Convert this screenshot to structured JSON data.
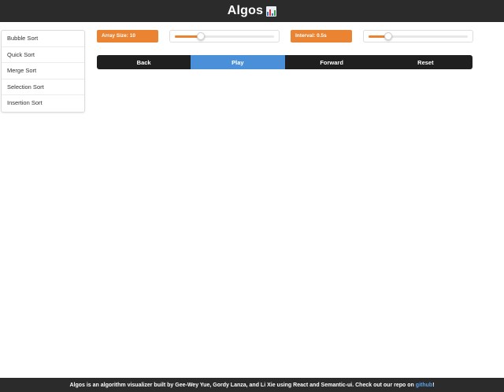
{
  "header": {
    "title": "Algos",
    "logo_icon": "bar-chart-icon"
  },
  "sidebar": {
    "items": [
      {
        "label": "Bubble Sort"
      },
      {
        "label": "Quick Sort"
      },
      {
        "label": "Merge Sort"
      },
      {
        "label": "Selection Sort"
      },
      {
        "label": "Insertion Sort"
      }
    ]
  },
  "settings": {
    "array_size_label": "Array Size: 10",
    "array_size_slider_level": 0.26,
    "interval_label": "Interval: 0.5s",
    "interval_slider_level": 0.2
  },
  "controls": {
    "back_label": "Back",
    "play_label": "Play",
    "forward_label": "Forward",
    "reset_label": "Reset"
  },
  "footer": {
    "text": "Algos is an algorithm visualizer built by Gee-Wey Yue, Gordy Lanza, and Li Xie using React and Semantic-ui. Check out our repo on",
    "link_text": "github",
    "suffix": "!"
  },
  "colors": {
    "accent": "#ea8433",
    "active": "#4a90d9",
    "dark": "#1f1f1f"
  }
}
